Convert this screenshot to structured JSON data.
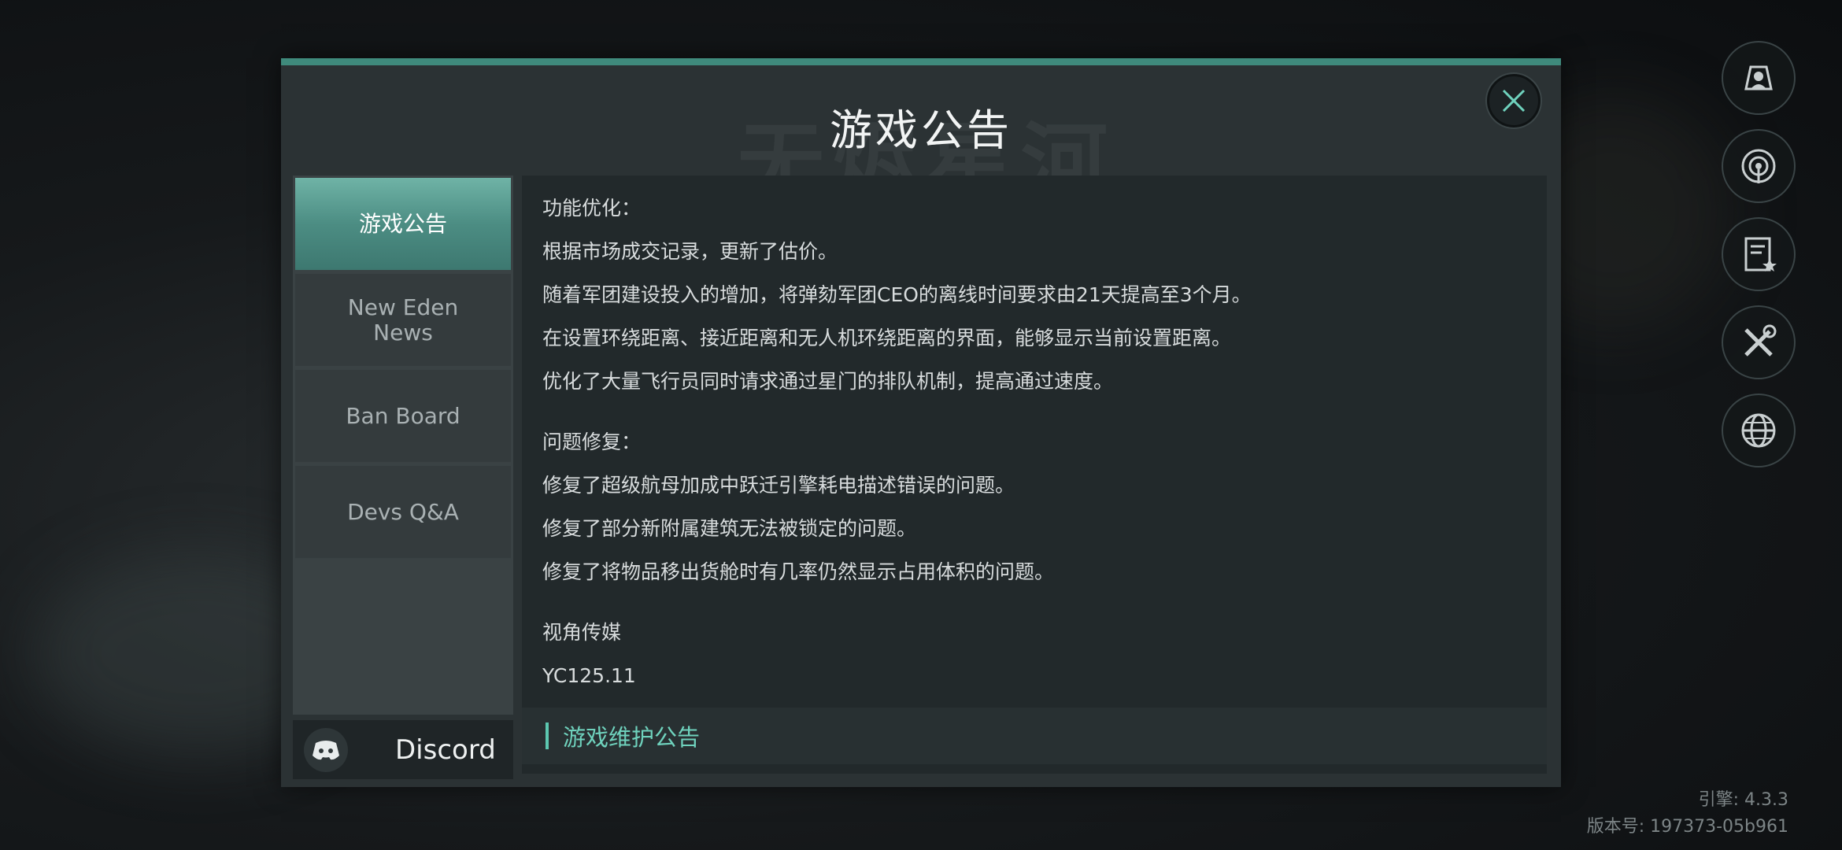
{
  "dialog": {
    "title": "游戏公告",
    "watermark": "无烬星河"
  },
  "sidebar": {
    "items": [
      {
        "label": "游戏公告",
        "active": true
      },
      {
        "label": "New Eden\nNews",
        "active": false
      },
      {
        "label": "Ban Board",
        "active": false
      },
      {
        "label": "Devs Q&A",
        "active": false
      }
    ],
    "discord_label": "Discord"
  },
  "content": {
    "lines": [
      "功能优化：",
      "根据市场成交记录，更新了估价。",
      "随着军团建设投入的增加，将弹劾军团CEO的离线时间要求由21天提高至3个月。",
      "在设置环绕距离、接近距离和无人机环绕距离的界面，能够显示当前设置距离。",
      "优化了大量飞行员同时请求通过星门的排队机制，提高通过速度。",
      "问题修复：",
      "修复了超级航母加成中跃迁引擎耗电描述错误的问题。",
      "修复了部分新附属建筑无法被锁定的问题。",
      "修复了将物品移出货舱时有几率仍然显示占用体积的问题。",
      "视角传媒",
      "YC125.11"
    ],
    "footer_link": "游戏维护公告"
  },
  "right_rail": {
    "icons": [
      "profile-icon",
      "signal-icon",
      "notes-icon",
      "tools-icon",
      "globe-icon"
    ]
  },
  "version": {
    "engine": "引擎: 4.3.3",
    "build": "版本号: 197373-05b961"
  },
  "colors": {
    "accent": "#3f8a7c",
    "accent_text": "#6fd2bd"
  }
}
